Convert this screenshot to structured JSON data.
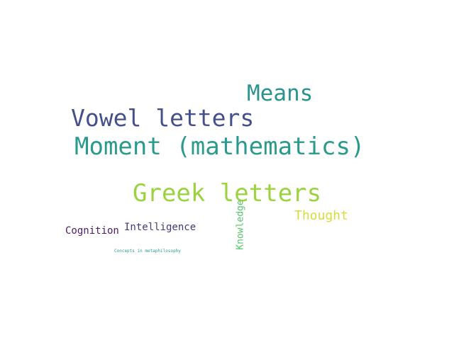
{
  "words": [
    {
      "id": "means",
      "text": "Means",
      "color": "#2a938c"
    },
    {
      "id": "vowel",
      "text": "Vowel letters",
      "color": "#45508a"
    },
    {
      "id": "moment",
      "text": "Moment (mathematics)",
      "color": "#2a9a8c"
    },
    {
      "id": "greek",
      "text": "Greek letters",
      "color": "#9ad33f"
    },
    {
      "id": "thought",
      "text": "Thought",
      "color": "#d8dc3c"
    },
    {
      "id": "cognition",
      "text": "Cognition",
      "color": "#4b1c64"
    },
    {
      "id": "intelligence",
      "text": "Intelligence",
      "color": "#3d3a7e"
    },
    {
      "id": "knowledge",
      "text": "Knowledge",
      "color": "#56c46a"
    },
    {
      "id": "concepts",
      "text": "Concepts in metaphilosophy",
      "color": "#2a9a8c"
    }
  ]
}
